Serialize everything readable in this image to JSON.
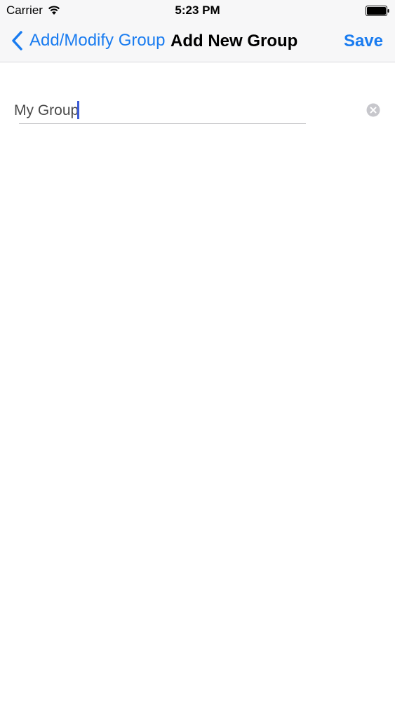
{
  "status_bar": {
    "carrier": "Carrier",
    "time": "5:23 PM",
    "wifi_icon": "wifi-icon",
    "battery_icon": "battery-icon"
  },
  "nav_bar": {
    "back_label": "Add/Modify Group",
    "back_icon": "chevron-left-icon",
    "title": "Add New Group",
    "save_label": "Save"
  },
  "form": {
    "group_name_value": "My Group",
    "clear_icon": "clear-icon"
  },
  "colors": {
    "accent": "#1a7cf0",
    "caret": "#3c5bd6",
    "nav_background": "#f7f7f8"
  }
}
